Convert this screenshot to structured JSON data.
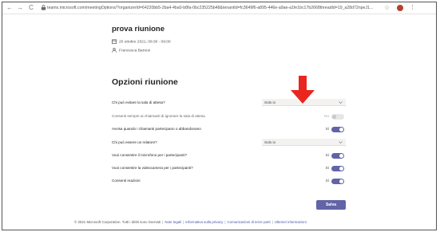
{
  "browser": {
    "url": "teams.microsoft.com/meetingOptions/?organizerId=64220bb5-2ba4-4ba0-b8fa-0bc235225b48&tenantId=fc3649f6-a895-446e-a9ae-a1fe1bc17b2668threadId=19_a28d72npeJ1..."
  },
  "meeting": {
    "title": "prova riunione",
    "datetime": "20 ottobre 2021, 08:30 - 09:00",
    "organizer": "Francesca Barresi"
  },
  "options": {
    "heading": "Opzioni riunione",
    "rows": [
      {
        "label": "Chi può evitare la sala di attesa?",
        "type": "select",
        "value": "Solo io"
      },
      {
        "label": "Consenti sempre ai chiamanti di ignorare la sala di attesa",
        "type": "toggle",
        "state_label": "No",
        "on": false,
        "disabled": true
      },
      {
        "label": "Avvisa quando i chiamanti partecipano o abbandonano",
        "type": "toggle",
        "state_label": "Sì",
        "on": true
      },
      {
        "label": "Chi può essere un relatore?",
        "type": "select",
        "value": "Solo io"
      },
      {
        "label": "Vuoi consentire il microfono per i partecipanti?",
        "type": "toggle",
        "state_label": "Sì",
        "on": true
      },
      {
        "label": "Vuoi consentire la videocamera per i partecipanti?",
        "type": "toggle",
        "state_label": "Sì",
        "on": true
      },
      {
        "label": "Consenti reazioni",
        "type": "toggle",
        "state_label": "Sì",
        "on": true
      }
    ],
    "save_label": "Salva"
  },
  "footer": {
    "copyright": "© 2021 Microsoft Corporation. Tutti i diritti sono riservati",
    "links": [
      "Note legali",
      "Informativa sulla privacy",
      "Comunicazioni di terze parti",
      "Ulteriori informazioni"
    ]
  },
  "colors": {
    "accent": "#6264a7",
    "annotation_arrow": "#e8261f"
  },
  "icons": [
    "back-arrow-icon",
    "forward-arrow-icon",
    "reload-icon",
    "lock-icon",
    "star-icon",
    "calendar-icon",
    "person-icon",
    "chevron-down-icon",
    "red-arrow-annotation"
  ]
}
